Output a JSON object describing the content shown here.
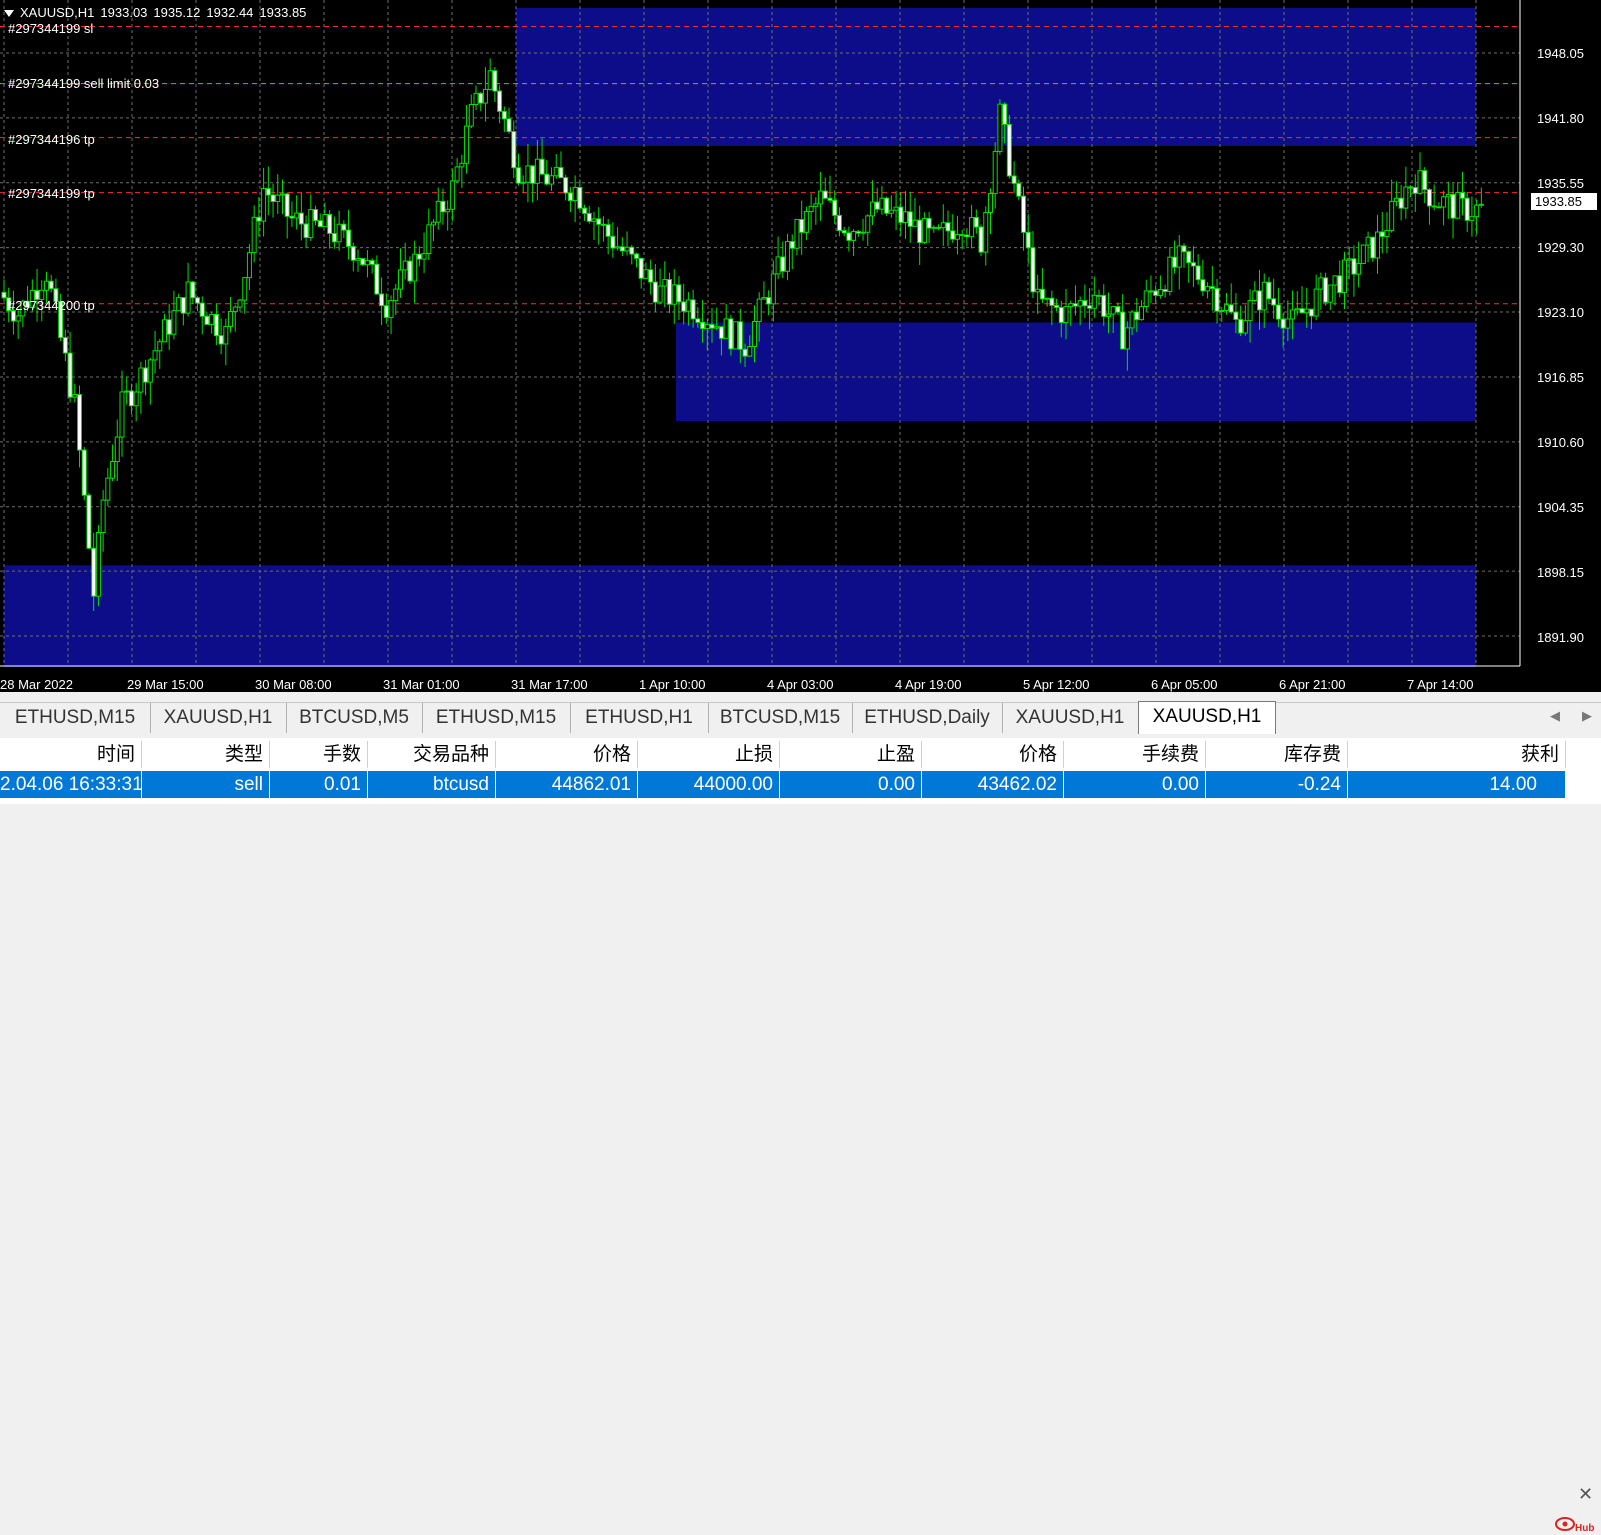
{
  "chart": {
    "symbol": "XAUUSD,H1",
    "open": "1933.03",
    "high": "1935.12",
    "low": "1932.44",
    "close": "1933.85",
    "current_price": "1933.85",
    "price_levels": [
      "1948.05",
      "1941.80",
      "1935.55",
      "1929.30",
      "1923.10",
      "1916.85",
      "1910.60",
      "1904.35",
      "1898.15",
      "1891.90"
    ],
    "time_labels": [
      "28 Mar 2022",
      "29 Mar 15:00",
      "30 Mar 08:00",
      "31 Mar 01:00",
      "31 Mar 17:00",
      "1 Apr 10:00",
      "4 Apr 03:00",
      "4 Apr 19:00",
      "5 Apr 12:00",
      "6 Apr 05:00",
      "6 Apr 21:00",
      "7 Apr 14:00"
    ],
    "order_lines": [
      {
        "label": "#297344199 sl",
        "price": 1950.6,
        "color": "#ff2a2a"
      },
      {
        "label": "#297344199 sell limit 0.03",
        "price": 1945.1,
        "color": "#3ccf3c"
      },
      {
        "label": "#297344196 tp",
        "price": 1939.9,
        "color": "#ff2a2a"
      },
      {
        "label": "#297344199 tp",
        "price": 1934.6,
        "color": "#ff2a2a"
      },
      {
        "label": "#297344200 tp",
        "price": 1923.9,
        "color": "#ff2a2a"
      }
    ],
    "zones": [
      {
        "from_time": "31 Mar 17:00",
        "to_time": "7 Apr 22:00",
        "price_top": 1952.4,
        "price_bottom": 1939.1
      },
      {
        "from_time": "1 Apr 14:00",
        "to_time": "7 Apr 22:00",
        "price_top": 1922.1,
        "price_bottom": 1912.6
      },
      {
        "from_time": "28 Mar 2022",
        "to_time": "7 Apr 22:00",
        "price_top": 1898.7,
        "price_bottom": 1888.9
      }
    ],
    "colors": {
      "background": "#000000",
      "candle": "#00e000",
      "zone": "#0d0d8a",
      "grid": "#6e6e6e"
    }
  },
  "tabs": [
    {
      "label": "ETHUSD,M15",
      "active": false
    },
    {
      "label": "XAUUSD,H1",
      "active": false
    },
    {
      "label": "BTCUSD,M5",
      "active": false
    },
    {
      "label": "ETHUSD,M15",
      "active": false
    },
    {
      "label": "ETHUSD,H1",
      "active": false
    },
    {
      "label": "BTCUSD,M15",
      "active": false
    },
    {
      "label": "ETHUSD,Daily",
      "active": false
    },
    {
      "label": "XAUUSD,H1",
      "active": false
    },
    {
      "label": "XAUUSD,H1",
      "active": true
    }
  ],
  "table": {
    "headers": [
      "时间",
      "类型",
      "手数",
      "交易品种",
      "价格",
      "止损",
      "止盈",
      "价格",
      "手续费",
      "库存费",
      "获利"
    ],
    "row": [
      "2.04.06 16:33:31",
      "sell",
      "0.01",
      "btcusd",
      "44862.01",
      "44000.00",
      "0.00",
      "43462.02",
      "0.00",
      "-0.24",
      "14.00"
    ]
  },
  "watermark": "Hub"
}
